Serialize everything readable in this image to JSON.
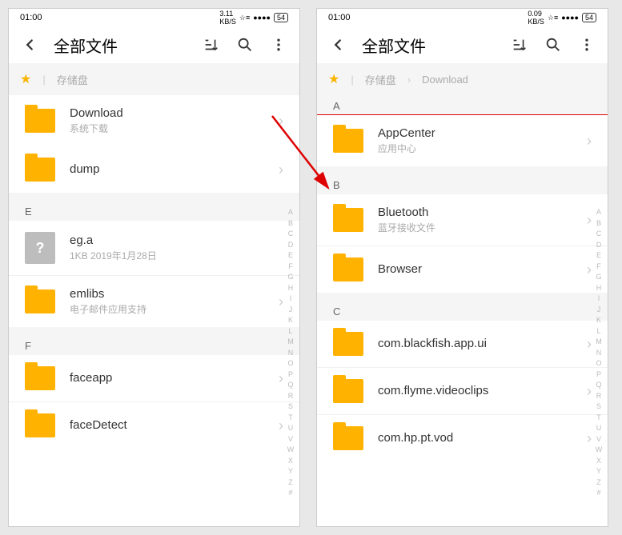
{
  "status": {
    "time": "01:00",
    "kbs1": "3.11",
    "kbs2": "0.09",
    "unit": "KB/S",
    "sig": "☆≡",
    "net": "●●●●",
    "batt": "54"
  },
  "header": {
    "title": "全部文件"
  },
  "crumbs": {
    "storage": "存储盘",
    "download": "Download"
  },
  "idx": "ABCDEFGHIJKLMNOPQRSTUVWXYZ#",
  "left": {
    "d": [
      {
        "n": "Download",
        "s": "系统下载"
      },
      {
        "n": "dump"
      }
    ],
    "e_hdr": "E",
    "e": [
      {
        "n": "eg.a",
        "s": "1KB  2019年1月28日",
        "file": true
      },
      {
        "n": "emlibs",
        "s": "电子邮件应用支持"
      }
    ],
    "f_hdr": "F",
    "f": [
      {
        "n": "faceapp"
      },
      {
        "n": "faceDetect"
      }
    ]
  },
  "right": {
    "a_hdr": "A",
    "a": [
      {
        "n": "AppCenter",
        "s": "应用中心"
      }
    ],
    "b_hdr": "B",
    "b": [
      {
        "n": "Bluetooth",
        "s": "蓝牙接收文件"
      },
      {
        "n": "Browser"
      }
    ],
    "c_hdr": "C",
    "c": [
      {
        "n": "com.blackfish.app.ui"
      },
      {
        "n": "com.flyme.videoclips"
      },
      {
        "n": "com.hp.pt.vod"
      }
    ]
  }
}
